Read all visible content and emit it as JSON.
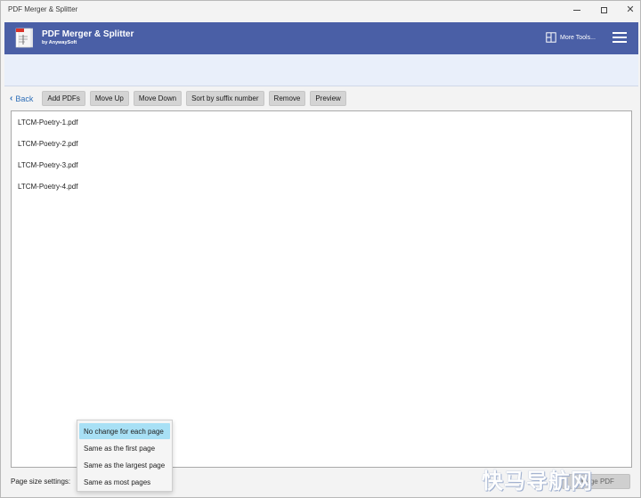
{
  "window": {
    "title": "PDF Merger & Splitter",
    "controls": {
      "minimize": "—",
      "maximize": "□",
      "close": "✕"
    }
  },
  "header": {
    "app_title": "PDF Merger & Splitter",
    "app_subtitle": "by AnywaySoft",
    "more_tools": "More Tools...",
    "accent_color": "#4a5fa6",
    "menu_icon": "hamburger-menu-icon"
  },
  "toolbar": {
    "back": "Back",
    "add_pdfs": "Add PDFs",
    "move_up": "Move Up",
    "move_down": "Move Down",
    "sort_suffix": "Sort by suffix number",
    "remove": "Remove",
    "preview": "Preview"
  },
  "files": [
    "LTCM-Poetry-1.pdf",
    "LTCM-Poetry-2.pdf",
    "LTCM-Poetry-3.pdf",
    "LTCM-Poetry-4.pdf"
  ],
  "bottom": {
    "page_size_label": "Page size settings:",
    "merge_button": "Merge PDF"
  },
  "page_size_options": {
    "selected_index": 0,
    "items": [
      "No change for each page",
      "Same as the first page",
      "Same as the largest page",
      "Same as most pages"
    ]
  },
  "watermark": "快马导航网"
}
